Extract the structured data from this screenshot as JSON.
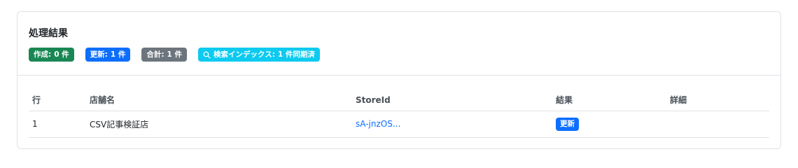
{
  "card": {
    "title": "処理結果",
    "badges": {
      "created": {
        "label": "作成:",
        "value": "0 件",
        "color": "#198754"
      },
      "updated": {
        "label": "更新:",
        "value": "1 件",
        "color": "#0d6efd"
      },
      "total": {
        "label": "合計:",
        "value": "1 件",
        "color": "#6c757d"
      },
      "search_index": {
        "label": "検索インデックス:",
        "value": "1 件同期済",
        "color": "#0dcaf0",
        "icon": "search-icon"
      }
    }
  },
  "table": {
    "headers": {
      "row": "行",
      "store_name": "店舗名",
      "store_id": "StoreId",
      "result": "結果",
      "details": "詳細"
    },
    "rows": [
      {
        "row": "1",
        "store_name": "CSV記事検証店",
        "store_id": "sA-jnzOS...",
        "result": "更新",
        "details": ""
      }
    ]
  }
}
